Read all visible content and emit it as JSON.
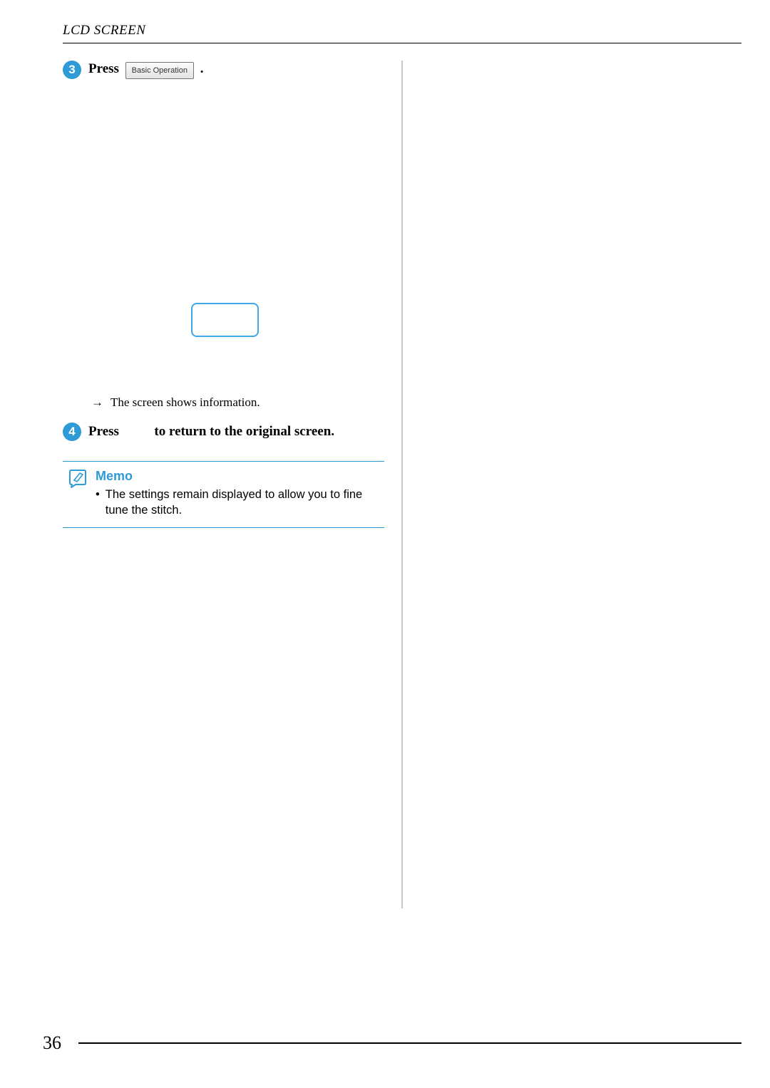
{
  "header": {
    "section_title": "LCD SCREEN"
  },
  "steps": {
    "s3": {
      "num": "3",
      "press": "Press",
      "button_label": "Basic Operation",
      "period": "."
    },
    "arrow_note": "The screen shows information.",
    "s4": {
      "num": "4",
      "press": "Press",
      "rest": "to return to the original screen."
    }
  },
  "memo": {
    "title": "Memo",
    "bullet": "The settings remain displayed to allow you to fine tune the stitch."
  },
  "footer": {
    "page_number": "36"
  }
}
